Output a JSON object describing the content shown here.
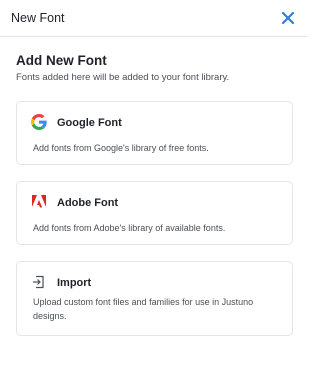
{
  "header": {
    "title": "New Font",
    "close_icon": "close-icon",
    "accent_color": "#2f7ed8"
  },
  "section": {
    "title": "Add New Font",
    "subtitle": "Fonts added here will be added to your font library."
  },
  "cards": [
    {
      "icon": "google-logo-icon",
      "title": "Google Font",
      "description": "Add fonts from Google's library of free fonts."
    },
    {
      "icon": "adobe-logo-icon",
      "title": "Adobe Font",
      "description": "Add fonts from Adobe's library of available fonts.",
      "icon_color": "#e1251b"
    },
    {
      "icon": "import-icon",
      "title": "Import",
      "description": "Upload custom font files and families for use in Justuno designs."
    }
  ]
}
